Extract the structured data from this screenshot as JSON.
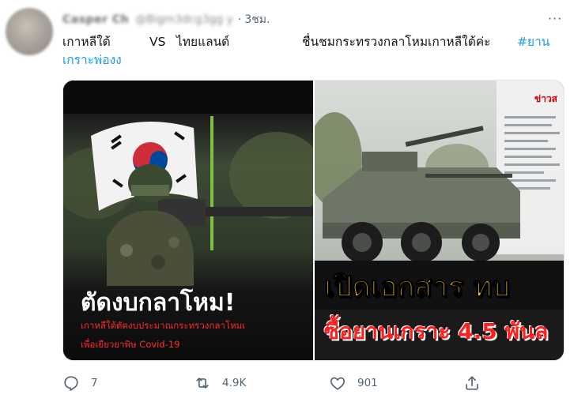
{
  "tweet": {
    "author_name": "Casper Ch",
    "handle": "@Bigm3dcg3gg y",
    "dot": "·",
    "time": "3ชม.",
    "more": "···",
    "text_line1_part1": "เกาหลีใต้",
    "text_line1_part2": "VS",
    "text_line1_part3": "ไทยแลนด์",
    "text_line1_part4": "ชื่นชมกระทรวงกลาโหมเกาหลีใต้ค่ะ",
    "text_hashtag1": "#ยาน",
    "text_hashtag2": "เกราะพ่องง"
  },
  "media": {
    "left": {
      "headline": "ตัดงบกลาโหม!",
      "sub_line1": "เกาหลีใต้ตัดงบประมาณกระทรวงกลาโหมเ",
      "sub_line2": "เพื่อเยียวยาพิษ Covid-19"
    },
    "right": {
      "news_tag": "ข่าวส",
      "headline": "เปิดเอกสาร ทบ",
      "sub": "ซื้อยานเกราะ 4.5 พันล"
    }
  },
  "actions": {
    "reply_count": "7",
    "retweet_count": "4.9K",
    "like_count": "901"
  },
  "colors": {
    "hashtag": "#1d9bf0",
    "muted": "#536471",
    "yellow": "#ffd800",
    "red": "#ff1e1e"
  }
}
